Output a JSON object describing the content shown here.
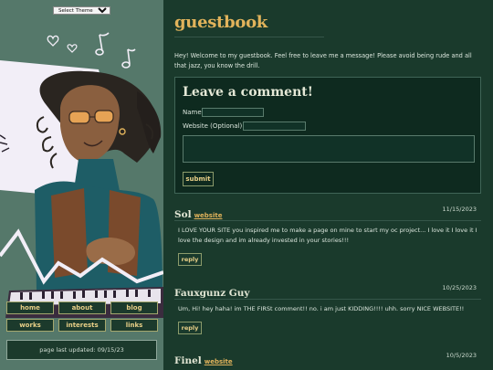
{
  "sidebar": {
    "theme_select": "Select Theme",
    "nav": [
      {
        "label": "home",
        "name": "nav-home-button"
      },
      {
        "label": "about",
        "name": "nav-about-button"
      },
      {
        "label": "blog",
        "name": "nav-blog-button"
      },
      {
        "label": "works",
        "name": "nav-works-button"
      },
      {
        "label": "interests",
        "name": "nav-interests-button"
      },
      {
        "label": "links",
        "name": "nav-links-button"
      }
    ],
    "last_updated": "page last updated: 09/15/23"
  },
  "main": {
    "title": "guestbook",
    "intro": "Hey! Welcome to my guestbook. Feel free to leave me a message! Please avoid being rude and all that jazz, you know the drill.",
    "form": {
      "heading": "Leave a comment!",
      "name_label": "Name",
      "website_label": "Website (Optional)",
      "submit_label": "submit"
    },
    "entries": [
      {
        "name": "Sol",
        "website": "website",
        "date": "11/15/2023",
        "text": "I LOVE YOUR SITE you inspired me to make a page on mine to start my oc project... I love it I love it I love the design and im already invested in your stories!!!",
        "reply": "reply"
      },
      {
        "name": "Fauxgunz Guy",
        "website": "",
        "date": "10/25/2023",
        "text": "Um, Hi! hey haha! im THE FIRSt comment!! no. i am just KIDDING!!!! uhh. sorry NICE WEBSITE!!",
        "reply": "reply"
      },
      {
        "name": "Finel",
        "website": "website",
        "date": "10/5/2023",
        "text": "",
        "reply": ""
      }
    ]
  },
  "colors": {
    "accent": "#e1b35b",
    "sidebar_bg": "#55786a",
    "main_bg": "#1a3a2c",
    "form_bg": "#0e2a1f"
  }
}
